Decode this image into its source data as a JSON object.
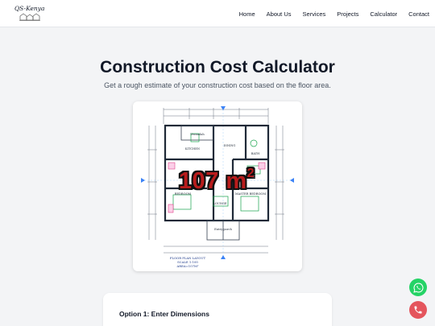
{
  "brand": {
    "name": "QS-Kenya"
  },
  "nav": {
    "links": [
      "Home",
      "About Us",
      "Services",
      "Projects",
      "Calculator",
      "Contact"
    ]
  },
  "hero": {
    "title": "Construction Cost Calculator",
    "subtitle": "Get a rough estimate of your construction cost based on the floor area."
  },
  "floor_plan": {
    "area_value": "107 m",
    "area_unit_sup": "2",
    "rooms": [
      "Verandah",
      "KITCHEN",
      "DINING",
      "BATH",
      "BEDROOM",
      "LOUNGE",
      "MASTER BEDROOM",
      "Entry porch"
    ],
    "caption_lines": [
      "FLOOR PLAN LAYOUT",
      "SCALE 1:100",
      "AREA=107M²"
    ]
  },
  "form": {
    "option1_heading": "Option 1: Enter Dimensions"
  },
  "colors": {
    "whatsapp": "#25d366",
    "call": "#e4555d",
    "badge_red": "#b91c1c",
    "plan_blue": "#3b82f6",
    "wall": "#1f2937"
  },
  "icons": {
    "whatsapp": "whatsapp-icon",
    "call": "phone-icon"
  }
}
